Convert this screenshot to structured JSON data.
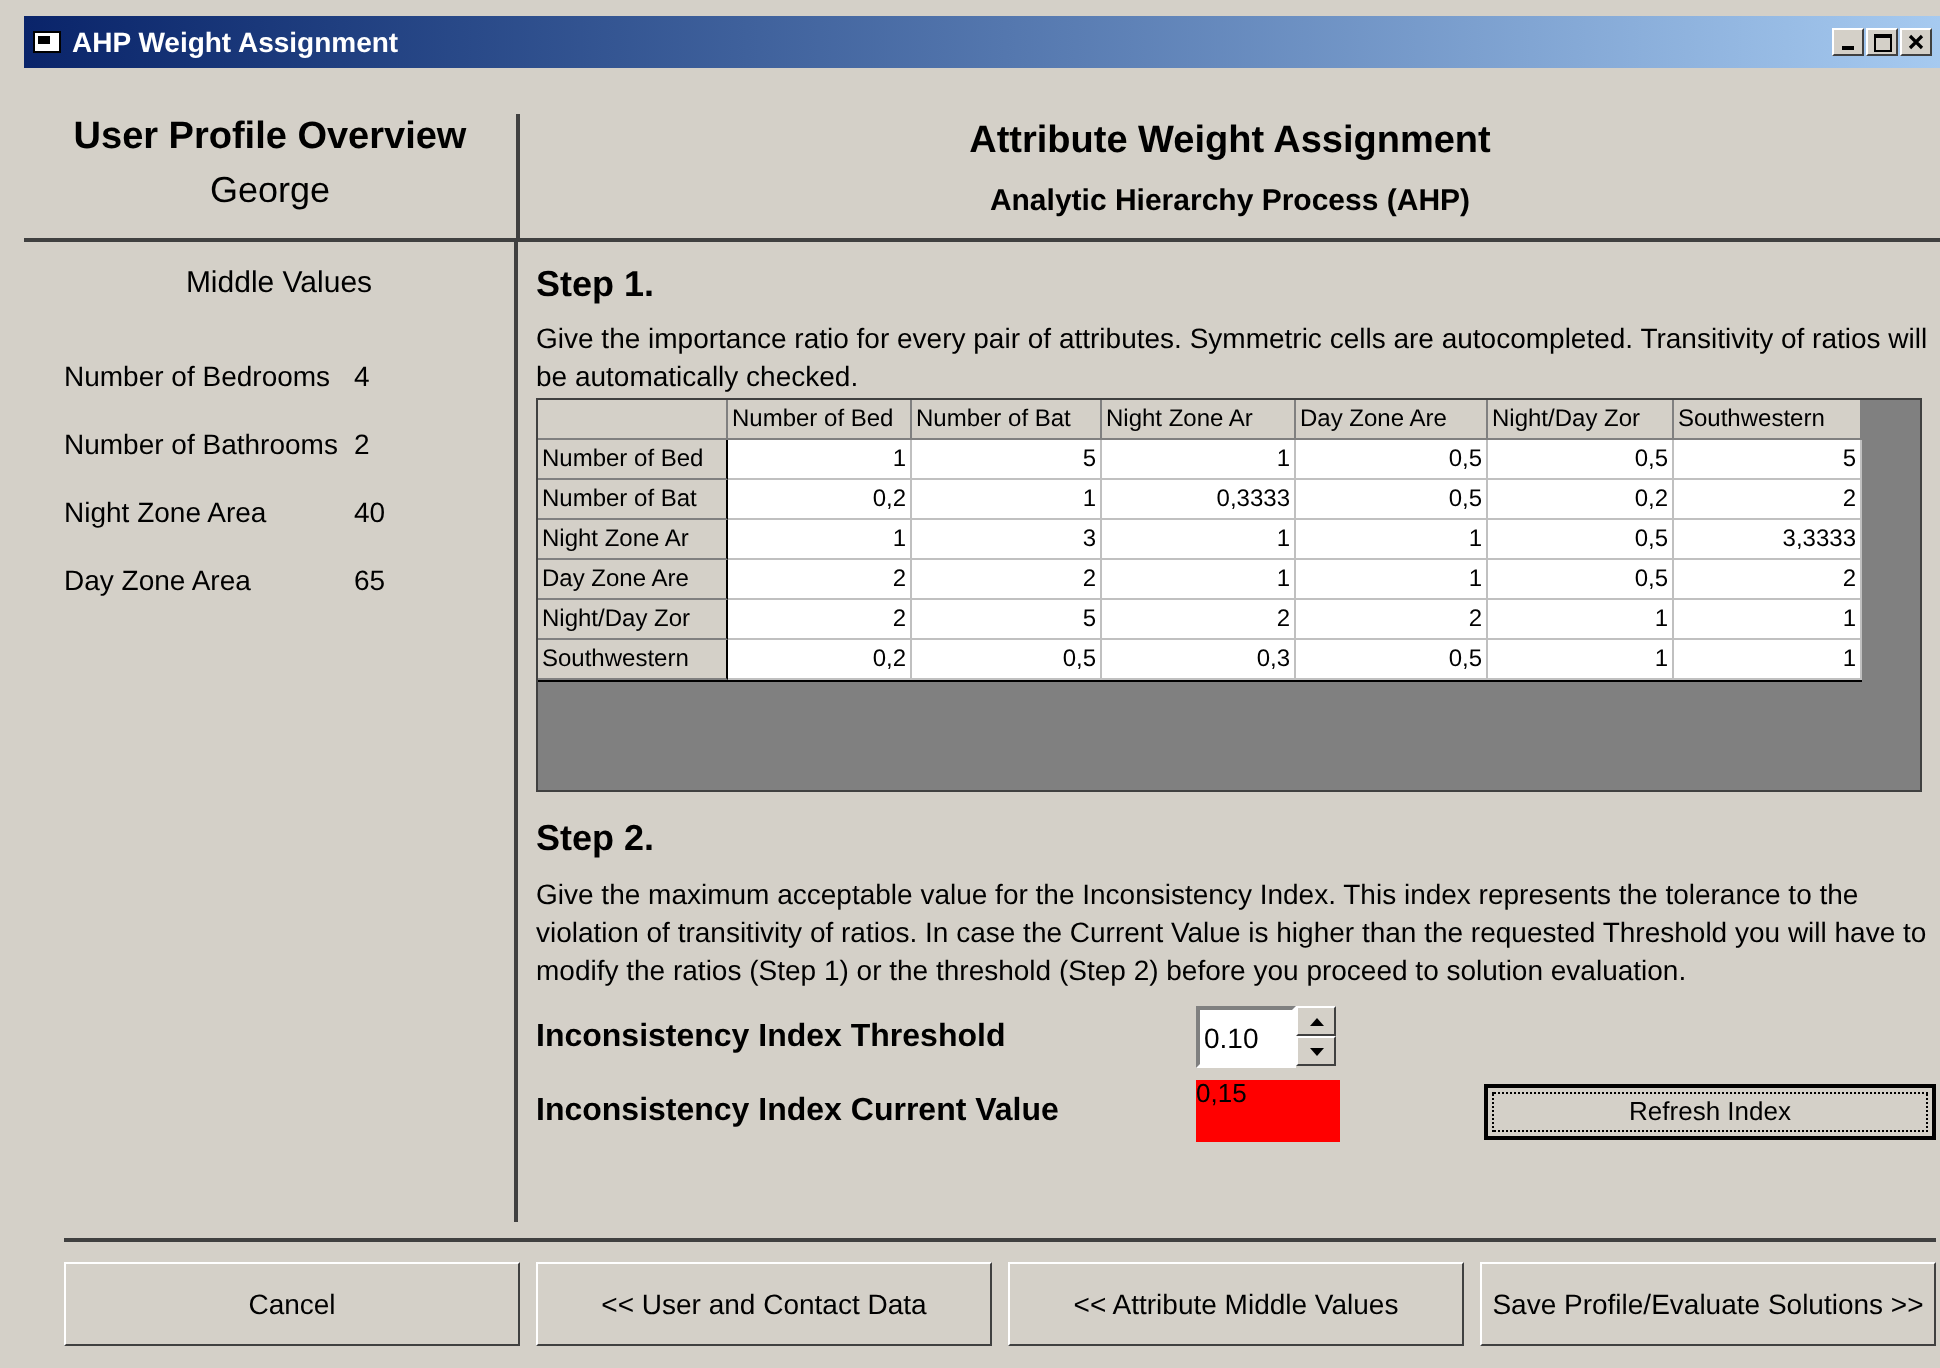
{
  "window": {
    "title": "AHP Weight Assignment"
  },
  "profile": {
    "title": "User Profile Overview",
    "name": "George",
    "section": "Middle Values",
    "values": [
      {
        "label": "Number of Bedrooms",
        "value": "4"
      },
      {
        "label": "Number of Bathrooms",
        "value": "2"
      },
      {
        "label": "Night Zone Area",
        "value": "40"
      },
      {
        "label": "Day Zone Area",
        "value": "65"
      }
    ]
  },
  "header": {
    "title": "Attribute Weight Assignment",
    "subtitle": "Analytic Hierarchy Process (AHP)"
  },
  "step1": {
    "title": "Step 1.",
    "text": "Give the importance ratio for every pair of attributes. Symmetric cells are autocompleted. Transitivity of ratios will be automatically checked.",
    "table": {
      "columns": [
        "Number of Bed",
        "Number of Bat",
        "Night Zone Ar",
        "Day Zone Are",
        "Night/Day Zor",
        "Southwestern"
      ],
      "rows": [
        {
          "label": "Number of Bed",
          "cells": [
            "1",
            "5",
            "1",
            "0,5",
            "0,5",
            "5"
          ]
        },
        {
          "label": "Number of Bat",
          "cells": [
            "0,2",
            "1",
            "0,3333",
            "0,5",
            "0,2",
            "2"
          ]
        },
        {
          "label": "Night Zone Ar",
          "cells": [
            "1",
            "3",
            "1",
            "1",
            "0,5",
            "3,3333"
          ]
        },
        {
          "label": "Day Zone Are",
          "cells": [
            "2",
            "2",
            "1",
            "1",
            "0,5",
            "2"
          ]
        },
        {
          "label": "Night/Day Zor",
          "cells": [
            "2",
            "5",
            "2",
            "2",
            "1",
            "1"
          ]
        },
        {
          "label": "Southwestern",
          "cells": [
            "0,2",
            "0,5",
            "0,3",
            "0,5",
            "1",
            "1"
          ]
        }
      ]
    }
  },
  "step2": {
    "title": "Step 2.",
    "text": "Give the maximum acceptable value for the Inconsistency Index. This index represents the tolerance to the violation of transitivity of ratios. In case the Current Value is higher than the requested Threshold you will have to modify the ratios (Step 1) or the threshold (Step 2) before you proceed to solution evaluation.",
    "threshold_label": "Inconsistency Index Threshold",
    "threshold_value": "0.10",
    "current_label": "Inconsistency Index Current Value",
    "current_value": "0,15",
    "current_alert": true,
    "refresh_button": "Refresh Index"
  },
  "buttons": [
    "Cancel",
    "<< User and Contact Data",
    "<< Attribute Middle Values",
    "Save Profile/Evaluate Solutions >>"
  ]
}
